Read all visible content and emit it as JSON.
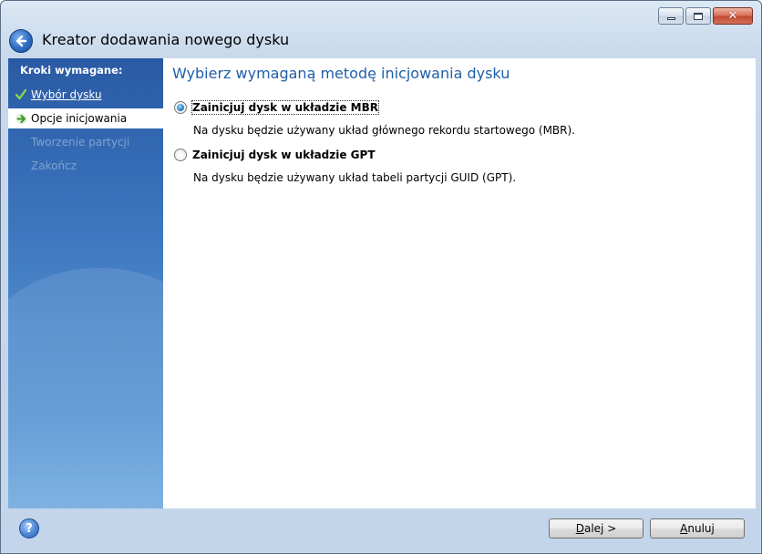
{
  "window": {
    "title": "Kreator dodawania nowego dysku",
    "caption_buttons": {
      "minimize_icon": "minimize-icon",
      "maximize_icon": "maximize-icon",
      "close_icon": "close-icon",
      "close_glyph": "✕"
    },
    "back_icon": "back-arrow-icon"
  },
  "sidebar": {
    "heading": "Kroki wymagane:",
    "steps": [
      {
        "label": "Wybór dysku",
        "state": "done",
        "icon": "checkmark-icon"
      },
      {
        "label": "Opcje inicjowania",
        "state": "current",
        "icon": "arrow-right-icon"
      },
      {
        "label": "Tworzenie partycji",
        "state": "pending",
        "icon": "none"
      },
      {
        "label": "Zakończ",
        "state": "pending",
        "icon": "none"
      }
    ]
  },
  "content": {
    "heading": "Wybierz wymaganą metodę inicjowania dysku",
    "options": [
      {
        "label": "Zainicjuj dysk w układzie MBR",
        "description": "Na dysku będzie używany układ głównego rekordu startowego (MBR).",
        "selected": true
      },
      {
        "label": "Zainicjuj dysk w układzie GPT",
        "description": "Na dysku będzie używany układ tabeli partycji GUID (GPT).",
        "selected": false
      }
    ]
  },
  "footer": {
    "help_glyph": "?",
    "next_label_u": "D",
    "next_label_rest": "alej >",
    "cancel_label_u": "A",
    "cancel_label_rest": "nuluj"
  },
  "colors": {
    "heading_blue": "#1f5fa8",
    "sidebar_blue": "#2f63ad",
    "pending_step": "#7fa3d1",
    "close_red": "#c24a33"
  }
}
